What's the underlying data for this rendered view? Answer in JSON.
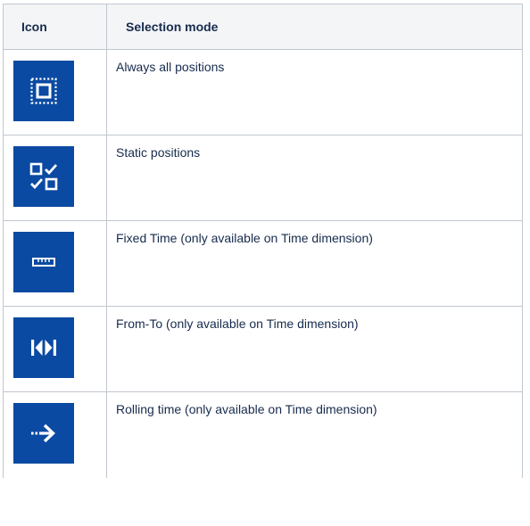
{
  "table": {
    "headers": {
      "icon": "Icon",
      "mode": "Selection mode"
    },
    "rows": [
      {
        "icon": "select-all-icon",
        "label": "Always all positions"
      },
      {
        "icon": "static-positions-icon",
        "label": "Static positions"
      },
      {
        "icon": "fixed-time-ruler-icon",
        "label": "Fixed Time (only available on Time dimension)"
      },
      {
        "icon": "from-to-icon",
        "label": "From-To (only available on Time dimension)"
      },
      {
        "icon": "rolling-time-arrow-icon",
        "label": "Rolling time (only available on Time dimension)"
      }
    ]
  },
  "colors": {
    "icon_tile": "#0b4aa2",
    "icon_glyph": "#ffffff",
    "header_bg": "#f4f5f7",
    "border": "#c1c7d0"
  }
}
